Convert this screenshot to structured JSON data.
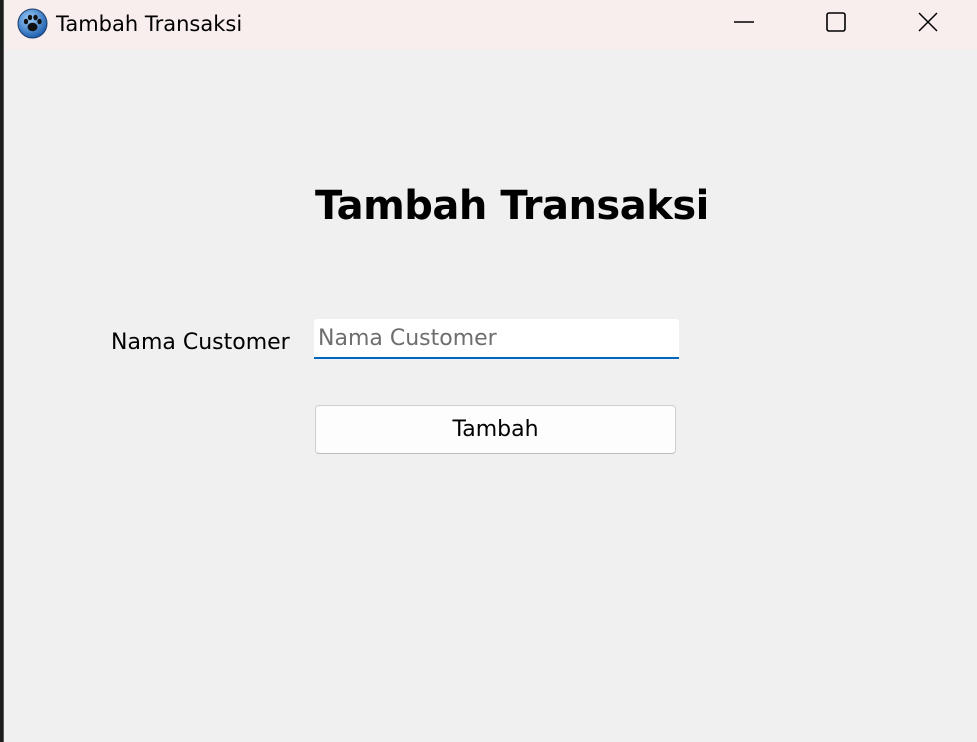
{
  "window": {
    "title": "Tambah Transaksi",
    "icon": "paw-app-icon",
    "controls": {
      "minimize": "minimize-icon",
      "maximize": "maximize-icon",
      "close": "close-icon"
    }
  },
  "form": {
    "heading": "Tambah Transaksi",
    "customer_label": "Nama Customer",
    "customer_input": {
      "value": "",
      "placeholder": "Nama Customer"
    },
    "submit_label": "Tambah"
  },
  "colors": {
    "titlebar_bg": "#f9eeee",
    "window_bg": "#f0f0f0",
    "input_accent": "#0067c0",
    "icon_blue": "#1f6fc5"
  }
}
